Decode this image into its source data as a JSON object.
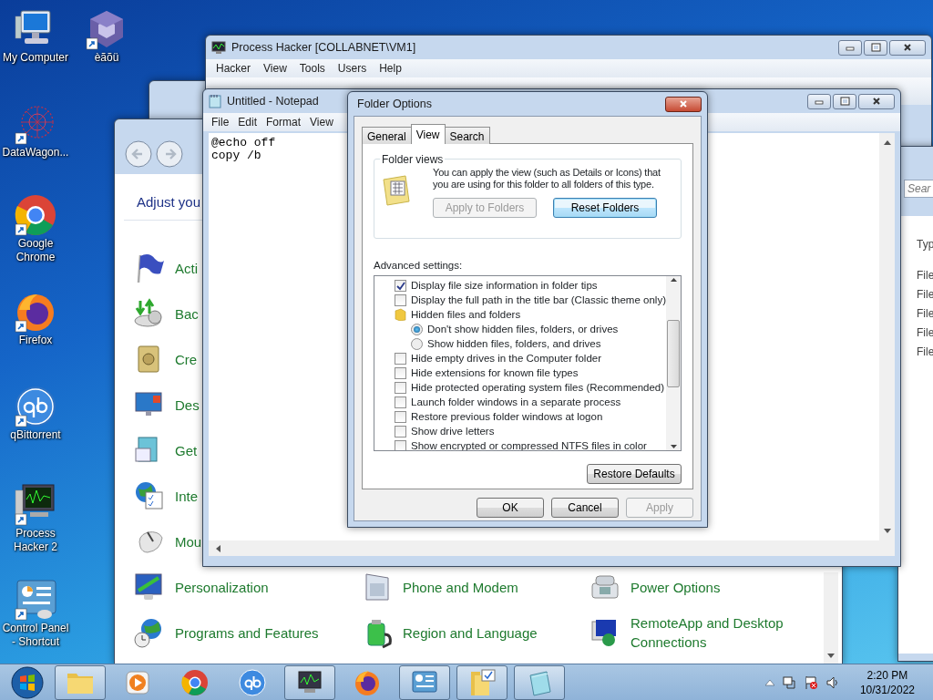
{
  "desktop_icons": [
    {
      "label": "My Computer"
    },
    {
      "label": "èãõü"
    },
    {
      "label": "DataWagon..."
    },
    {
      "label": "Google Chrome"
    },
    {
      "label": "Firefox"
    },
    {
      "label": "qBittorrent"
    },
    {
      "label": "Process Hacker 2"
    },
    {
      "label": "Control Panel - Shortcut"
    }
  ],
  "process_hacker": {
    "title": "Process Hacker [COLLABNET\\VM1]",
    "menu": [
      "Hacker",
      "View",
      "Tools",
      "Users",
      "Help"
    ]
  },
  "explorer": {
    "search_placeholder": "Sear",
    "column": "Typ",
    "rows": [
      "File",
      "File",
      "File",
      "File",
      "File"
    ]
  },
  "control_panel": {
    "heading": "Adjust you",
    "rows": [
      [
        {
          "label": "Acti"
        }
      ],
      [
        {
          "label": "Bac"
        }
      ],
      [
        {
          "label": "Cre"
        }
      ],
      [
        {
          "label": "Des"
        }
      ],
      [
        {
          "label": "Get"
        }
      ],
      [
        {
          "label": "Inte"
        }
      ],
      [
        {
          "label": "Mou"
        }
      ],
      [
        {
          "label": "Personalization"
        },
        {
          "label": "Phone and Modem"
        },
        {
          "label": "Power Options"
        }
      ],
      [
        {
          "label": "Programs and Features"
        },
        {
          "label": "Region and Language"
        },
        {
          "label": "RemoteApp and Desktop Connections"
        }
      ]
    ]
  },
  "notepad": {
    "title": "Untitled - Notepad",
    "menu": [
      "File",
      "Edit",
      "Format",
      "View"
    ],
    "lines": [
      "@echo off",
      "copy /b"
    ]
  },
  "folder_options": {
    "title": "Folder Options",
    "tabs": [
      {
        "label": "General",
        "selected": false
      },
      {
        "label": "View",
        "selected": true
      },
      {
        "label": "Search",
        "selected": false
      }
    ],
    "folder_views": {
      "legend": "Folder views",
      "description": "You can apply the view (such as Details or Icons) that you are using for this folder to all folders of this type.",
      "buttons": [
        {
          "label": "Apply to Folders",
          "disabled": true,
          "focused": false
        },
        {
          "label": "Reset Folders",
          "disabled": false,
          "focused": true
        }
      ]
    },
    "advanced_label": "Advanced settings:",
    "settings": [
      {
        "kind": "checkbox",
        "label": "Display file size information in folder tips",
        "checked": true
      },
      {
        "kind": "checkbox",
        "label": "Display the full path in the title bar (Classic theme only)",
        "checked": false
      },
      {
        "kind": "folder",
        "label": "Hidden files and folders",
        "children": [
          {
            "kind": "radio",
            "label": "Don't show hidden files, folders, or drives",
            "selected": true
          },
          {
            "kind": "radio",
            "label": "Show hidden files, folders, and drives",
            "selected": false
          }
        ]
      },
      {
        "kind": "checkbox",
        "label": "Hide empty drives in the Computer folder",
        "checked": false
      },
      {
        "kind": "checkbox",
        "label": "Hide extensions for known file types",
        "checked": false
      },
      {
        "kind": "checkbox",
        "label": "Hide protected operating system files (Recommended)",
        "checked": false
      },
      {
        "kind": "checkbox",
        "label": "Launch folder windows in a separate process",
        "checked": false
      },
      {
        "kind": "checkbox",
        "label": "Restore previous folder windows at logon",
        "checked": false
      },
      {
        "kind": "checkbox",
        "label": "Show drive letters",
        "checked": false
      },
      {
        "kind": "checkbox",
        "label": "Show encrypted or compressed NTFS files in color",
        "checked": false
      }
    ],
    "restore_button": "Restore Defaults",
    "buttons": [
      {
        "label": "OK",
        "disabled": false
      },
      {
        "label": "Cancel",
        "disabled": false
      },
      {
        "label": "Apply",
        "disabled": true
      }
    ]
  },
  "taskbar": {
    "items": [
      {
        "open": true
      },
      {
        "open": false
      },
      {
        "open": false
      },
      {
        "open": false
      },
      {
        "open": true
      },
      {
        "open": false
      },
      {
        "open": true
      },
      {
        "open": true
      },
      {
        "open": true
      }
    ],
    "time": "2:20 PM",
    "date": "10/31/2022"
  }
}
